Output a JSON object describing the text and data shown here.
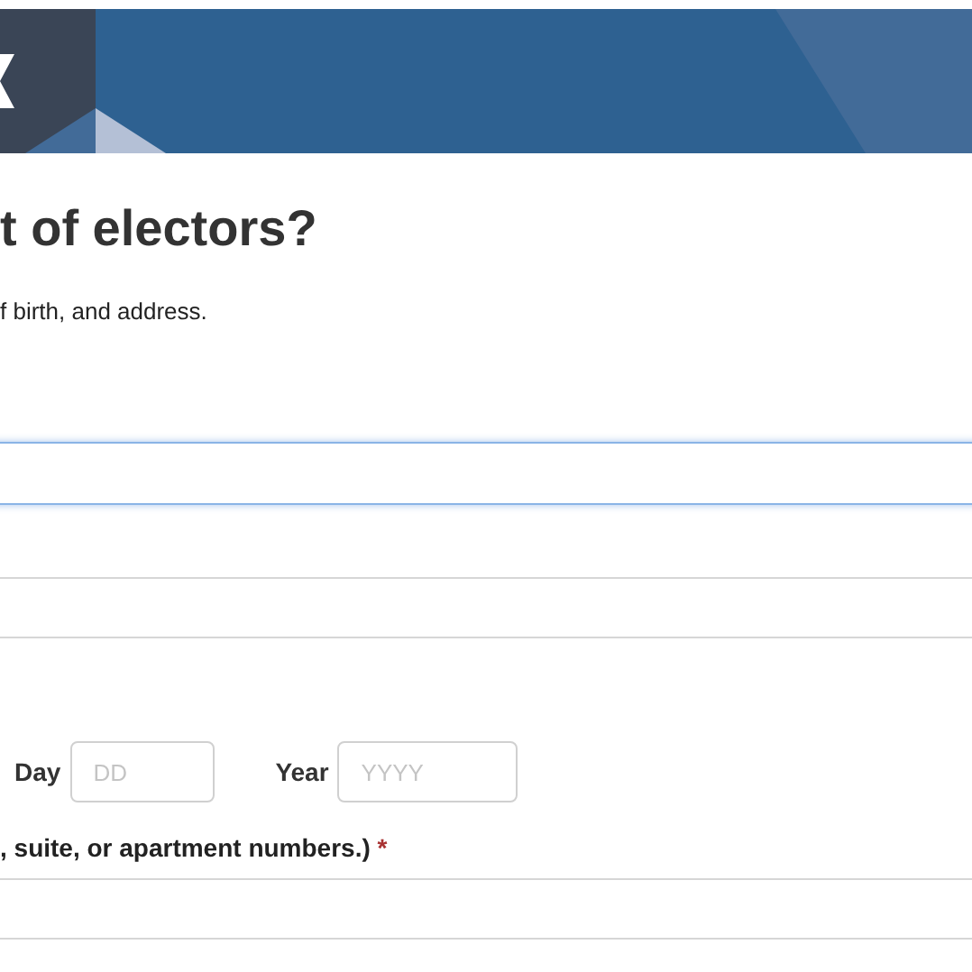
{
  "heading": "t of electors?",
  "intro": "f birth, and address.",
  "fields": [
    {
      "focused": true
    },
    {
      "focused": false
    }
  ],
  "date": [
    {
      "label": "Day",
      "placeholder": "DD"
    },
    {
      "label": "Year",
      "placeholder": "YYYY"
    }
  ],
  "address": {
    "label": ", suite, or apartment numbers.)",
    "required": "*"
  }
}
